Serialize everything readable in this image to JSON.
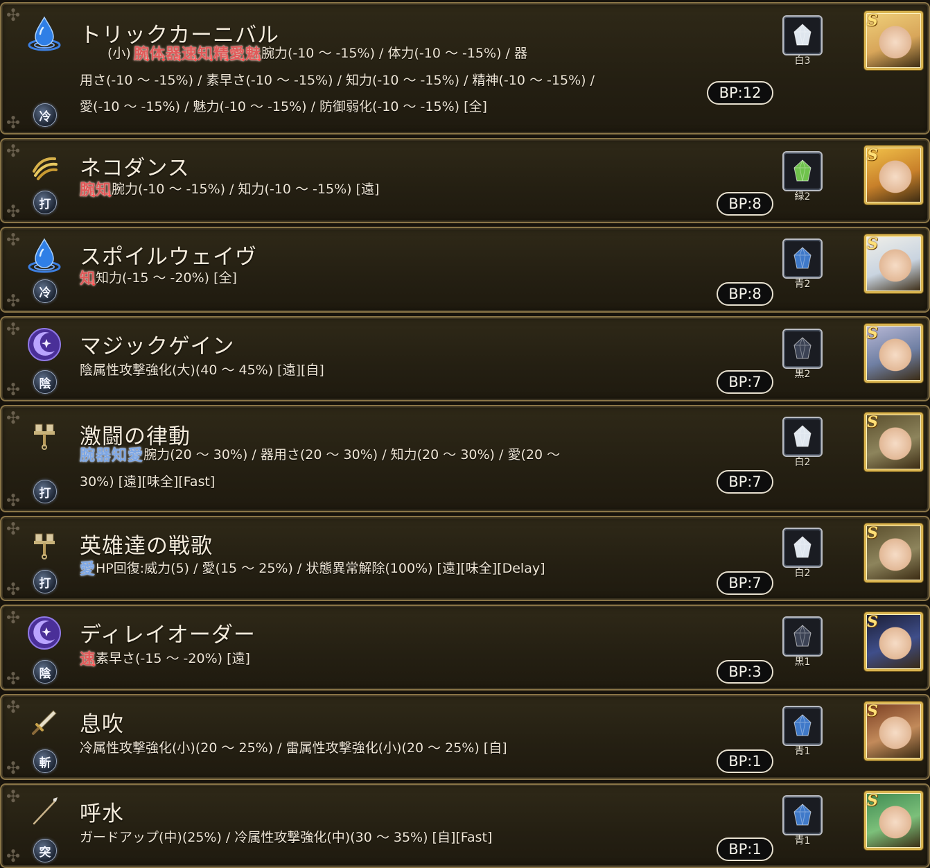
{
  "skills": [
    {
      "name": "トリックカーニバル",
      "type_icon": "water-drop-icon",
      "attack_icon": "cold-attack-icon",
      "attack_glyph": "冷",
      "prefix": "(小)",
      "buff_icons": [
        "腕",
        "体",
        "器",
        "速",
        "知",
        "精",
        "愛",
        "魅"
      ],
      "buff_direction": "down",
      "desc_lines": [
        "腕力(-10 ～ -15%) / 体力(-10 ～ -15%) / 器",
        "用さ(-10 ～ -15%) / 素早さ(-10 ～ -15%) / 知力(-10 ～ -15%) / 精神(-10 ～ -15%) /",
        "愛(-10 ～ -15%) / 魅力(-10 ～ -15%) / 防御弱化(-10 ～ -15%) [全]"
      ],
      "bp": "BP:12",
      "gem_label": "白3",
      "gem_color": "#dfe6ee",
      "portrait_bg": "#d8a65a",
      "portrait_hair": "#f0d07a"
    },
    {
      "name": "ネコダンス",
      "type_icon": "claw-icon",
      "attack_icon": "blunt-attack-icon",
      "attack_glyph": "打",
      "prefix": "",
      "buff_icons": [
        "腕",
        "知"
      ],
      "buff_direction": "down",
      "desc_lines": [
        "腕力(-10 ～ -15%) / 知力(-10 ～ -15%) [遠]"
      ],
      "bp": "BP:8",
      "gem_label": "緑2",
      "gem_color": "#6fc24c",
      "portrait_bg": "#c8802a",
      "portrait_hair": "#f2c24a"
    },
    {
      "name": "スポイルウェイヴ",
      "type_icon": "water-drop-icon",
      "attack_icon": "cold-attack-icon",
      "attack_glyph": "冷",
      "prefix": "",
      "buff_icons": [
        "知"
      ],
      "buff_direction": "down",
      "desc_lines": [
        "知力(-15 ～ -20%) [全]"
      ],
      "bp": "BP:8",
      "gem_label": "青2",
      "gem_color": "#3f79c9",
      "portrait_bg": "#c9d4e0",
      "portrait_hair": "#f0efe9"
    },
    {
      "name": "マジックゲイン",
      "type_icon": "crescent-moon-icon",
      "attack_icon": "dark-attack-icon",
      "attack_glyph": "陰",
      "prefix": "",
      "buff_icons": [],
      "buff_direction": "up",
      "desc_lines": [
        "陰属性攻撃強化(大)(40 ～ 45%) [遠][自]"
      ],
      "bp": "BP:7",
      "gem_label": "黒2",
      "gem_color": "#3b4254",
      "portrait_bg": "#6f7fa3",
      "portrait_hair": "#b9b9d6"
    },
    {
      "name": "激闘の律動",
      "type_icon": "hammer-icon",
      "attack_icon": "blunt-attack-icon",
      "attack_glyph": "打",
      "prefix": "",
      "buff_icons": [
        "腕",
        "器",
        "知",
        "愛"
      ],
      "buff_direction": "up",
      "desc_lines": [
        "腕力(20 ～ 30%) / 器用さ(20 ～ 30%) / 知力(20 ～ 30%) / 愛(20 ～",
        "30%) [遠][味全][Fast]"
      ],
      "bp": "BP:7",
      "gem_label": "白2",
      "gem_color": "#dfe6ee",
      "portrait_bg": "#8d845c",
      "portrait_hair": "#5a4e2c"
    },
    {
      "name": "英雄達の戦歌",
      "type_icon": "hammer-icon",
      "attack_icon": "blunt-attack-icon",
      "attack_glyph": "打",
      "prefix": "",
      "buff_icons": [
        "愛"
      ],
      "buff_direction": "up",
      "desc_lines": [
        "HP回復:威力(5) / 愛(15 ～ 25%) / 状態異常解除(100%) [遠][味全][Delay]"
      ],
      "bp": "BP:7",
      "gem_label": "白2",
      "gem_color": "#dfe6ee",
      "portrait_bg": "#8d845c",
      "portrait_hair": "#5a4e2c"
    },
    {
      "name": "ディレイオーダー",
      "type_icon": "crescent-moon-icon",
      "attack_icon": "dark-attack-icon",
      "attack_glyph": "陰",
      "prefix": "",
      "buff_icons": [
        "速"
      ],
      "buff_direction": "down",
      "desc_lines": [
        "素早さ(-15 ～ -20%) [遠]"
      ],
      "bp": "BP:3",
      "gem_label": "黒1",
      "gem_color": "#3b4254",
      "portrait_bg": "#3f4e8a",
      "portrait_hair": "#1a1d33"
    },
    {
      "name": "息吹",
      "type_icon": "sword-icon",
      "attack_icon": "slash-attack-icon",
      "attack_glyph": "斬",
      "prefix": "",
      "buff_icons": [],
      "buff_direction": "up",
      "desc_lines": [
        "冷属性攻撃強化(小)(20 ～ 25%) / 雷属性攻撃強化(小)(20 ～ 25%) [自]"
      ],
      "bp": "BP:1",
      "gem_label": "青1",
      "gem_color": "#3f79c9",
      "portrait_bg": "#c28a5a",
      "portrait_hair": "#7a3e22"
    },
    {
      "name": "呼水",
      "type_icon": "spear-icon",
      "attack_icon": "pierce-attack-icon",
      "attack_glyph": "突",
      "prefix": "",
      "buff_icons": [],
      "buff_direction": "up",
      "desc_lines": [
        "ガードアップ(中)(25%) / 冷属性攻撃強化(中)(30 ～ 35%) [自][Fast]"
      ],
      "bp": "BP:1",
      "gem_label": "青1",
      "gem_color": "#3f79c9",
      "portrait_bg": "#7cc07a",
      "portrait_hair": "#3f8a52"
    }
  ]
}
